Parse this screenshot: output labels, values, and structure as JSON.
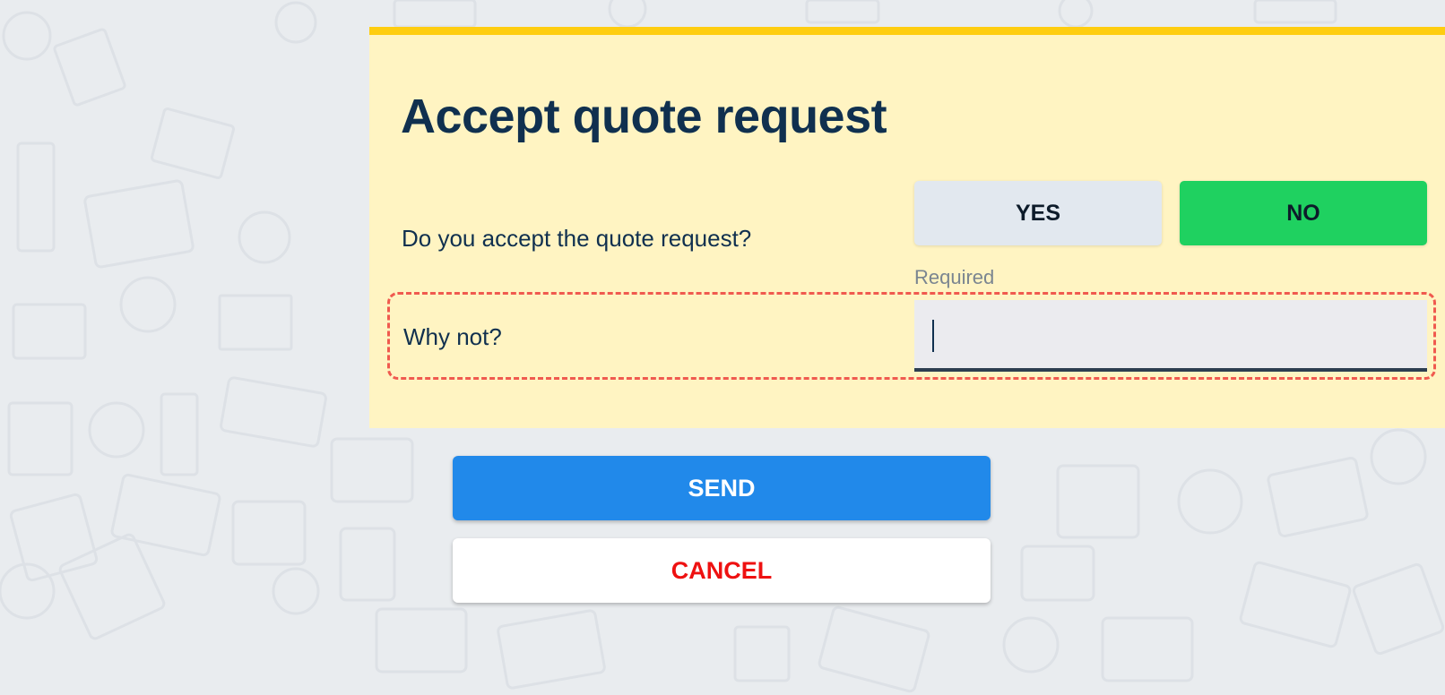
{
  "form": {
    "title": "Accept quote request",
    "question_label": "Do you accept the quote request?",
    "yes_label": "YES",
    "no_label": "NO",
    "selected": "NO",
    "required_label": "Required",
    "why_label": "Why not?",
    "why_value": "",
    "why_placeholder": ""
  },
  "actions": {
    "send_label": "SEND",
    "cancel_label": "CANCEL"
  },
  "colors": {
    "card_background": "#fff4c2",
    "card_accent": "#fecd10",
    "title_text": "#10304f",
    "yes_button": "#e2e8ef",
    "no_button_selected": "#1fd160",
    "send_button": "#2189ea",
    "cancel_text": "#ee1111",
    "highlight_border": "#f05a4f"
  },
  "icons": [
    "background-finance-pattern"
  ]
}
